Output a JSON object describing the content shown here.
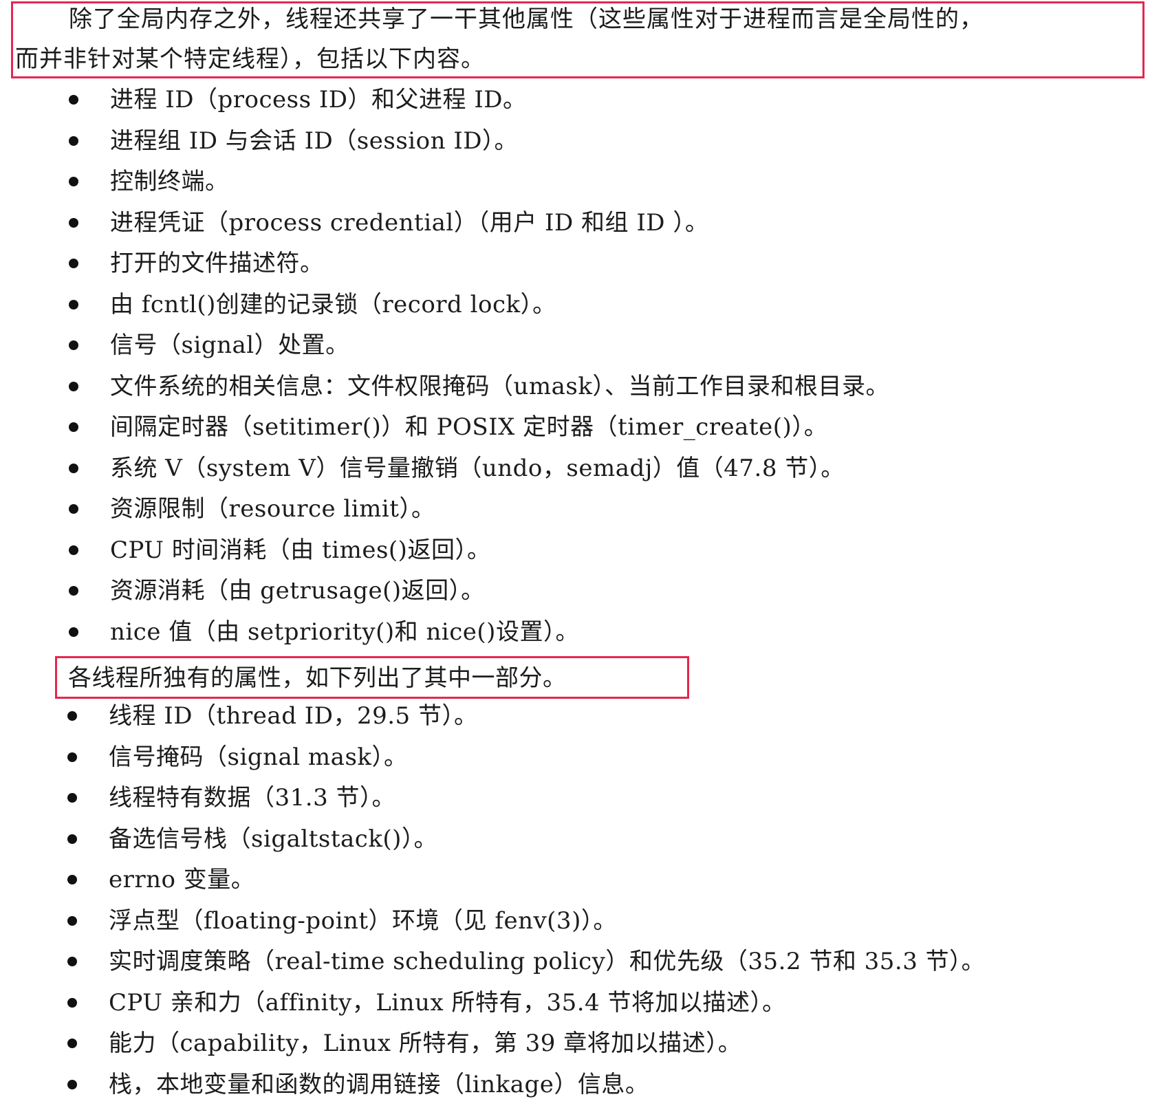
{
  "intro": {
    "line1": "除了全局内存之外，线程还共享了一干其他属性（这些属性对于进程而言是全局性的，",
    "line2": "而并非针对某个特定线程），包括以下内容。"
  },
  "shared_items": [
    "进程 ID（process ID）和父进程 ID。",
    "进程组 ID 与会话 ID（session ID）。",
    "控制终端。",
    "进程凭证（process credential）（用户 ID 和组 ID ）。",
    "打开的文件描述符。",
    "由 fcntl()创建的记录锁（record lock）。",
    "信号（signal）处置。",
    "文件系统的相关信息：文件权限掩码（umask）、当前工作目录和根目录。",
    "间隔定时器（setitimer()）和 POSIX 定时器（timer_create()）。",
    "系统 V（system V）信号量撤销（undo，semadj）值（47.8 节）。",
    "资源限制（resource limit）。",
    "CPU 时间消耗（由 times()返回）。",
    "资源消耗（由 getrusage()返回）。",
    "nice 值（由 setpriority()和 nice()设置）。"
  ],
  "unique_heading": "各线程所独有的属性，如下列出了其中一部分。",
  "unique_items": [
    "线程 ID（thread ID，29.5 节）。",
    "信号掩码（signal mask）。",
    "线程特有数据（31.3 节）。",
    "备选信号栈（sigaltstack()）。",
    "errno 变量。",
    "浮点型（floating-point）环境（见 fenv(3)）。",
    "实时调度策略（real-time scheduling policy）和优先级（35.2 节和 35.3 节）。",
    "CPU 亲和力（affinity，Linux 所特有，35.4 节将加以描述）。",
    "能力（capability，Linux 所特有，第 39 章将加以描述）。",
    "栈，本地变量和函数的调用链接（linkage）信息。"
  ],
  "colors": {
    "highlight_border": "#e5264e",
    "text": "#1c1c1c"
  }
}
